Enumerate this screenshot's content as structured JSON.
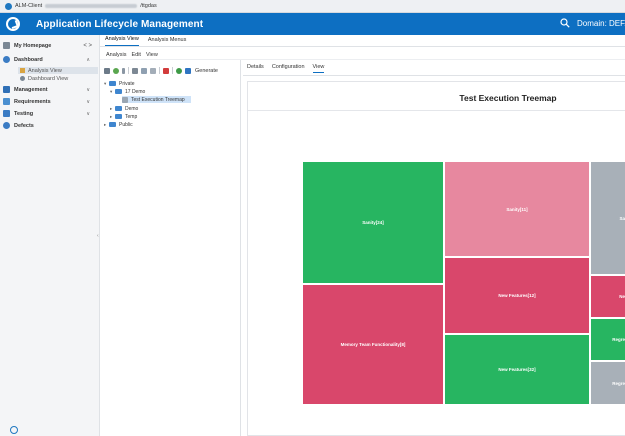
{
  "window": {
    "title_prefix": "ALM-Client",
    "title_suffix": "/ttgdas"
  },
  "header": {
    "app_title": "Application Lifecycle Management",
    "domain_label": "Domain: DEFA"
  },
  "sidebar": {
    "items": [
      {
        "label": "My Homepage",
        "arrows": "< >"
      },
      {
        "label": "Dashboard",
        "chevron": "∧"
      },
      {
        "label": "Management",
        "chevron": "∨"
      },
      {
        "label": "Requirements",
        "chevron": "∨"
      },
      {
        "label": "Testing",
        "chevron": "∨"
      },
      {
        "label": "Defects",
        "chevron": ""
      }
    ],
    "dashboard_subitems": [
      {
        "label": "Analysis View"
      },
      {
        "label": "Dashboard View"
      }
    ]
  },
  "module_tabs": [
    "Analysis View",
    "Analysis Menus"
  ],
  "menu": [
    "Analysis",
    "Edit",
    "View"
  ],
  "toolbar": {
    "generate_label": "Generate"
  },
  "tree": [
    {
      "label": "Private",
      "level": 0,
      "twisty": "▾",
      "type": "folder"
    },
    {
      "label": "17 Demo",
      "level": 1,
      "twisty": "▾",
      "type": "folder"
    },
    {
      "label": "Test Execution Treemap",
      "level": 2,
      "twisty": "",
      "type": "leaf"
    },
    {
      "label": "Demo",
      "level": 1,
      "twisty": "▸",
      "type": "folder"
    },
    {
      "label": "Temp",
      "level": 1,
      "twisty": "▸",
      "type": "folder"
    },
    {
      "label": "Public",
      "level": 0,
      "twisty": "▸",
      "type": "folder"
    }
  ],
  "detail_tabs": [
    "Details",
    "Configuration",
    "View"
  ],
  "colors": {
    "header_blue": "#0d6fc2",
    "treemap_green": "#27b561",
    "treemap_red": "#d9476b",
    "treemap_pink": "#e7889f",
    "treemap_gray": "#a8b0b8"
  },
  "chart_data": {
    "type": "treemap",
    "title": "Test Execution Treemap",
    "groups": [
      {
        "name": "Sanity",
        "cells": [
          {
            "label": "Sanity[24]",
            "value": 24,
            "color": "#27b561"
          },
          {
            "label": "Memory Team Functionality[8]",
            "value": 8,
            "color": "#d9476b"
          }
        ]
      },
      {
        "name": "New Features",
        "cells": [
          {
            "label": "Sanity[11]",
            "value": 11,
            "color": "#e7889f"
          },
          {
            "label": "New Features[12]",
            "value": 12,
            "color": "#d9476b"
          },
          {
            "label": "New Features[32]",
            "value": 32,
            "color": "#27b561"
          }
        ]
      },
      {
        "name": "Regression",
        "cells": [
          {
            "label": "Sa",
            "value": null,
            "color": "#a8b0b8"
          },
          {
            "label": "Ne",
            "value": null,
            "color": "#d9476b"
          },
          {
            "label": "Regre",
            "value": null,
            "color": "#27b561"
          },
          {
            "label": "Regre",
            "value": null,
            "color": "#a8b0b8"
          }
        ]
      }
    ]
  }
}
